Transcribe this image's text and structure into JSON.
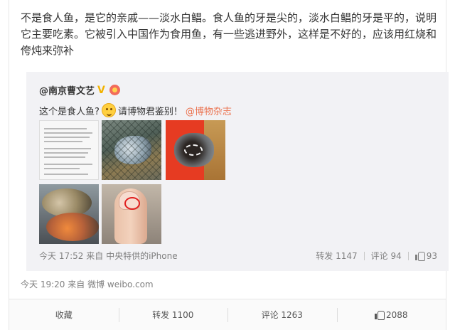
{
  "post": {
    "text": "不是食人鱼，是它的亲戚——淡水白鲳。食人鱼的牙是尖的，淡水白鲳的牙是平的，说明它主要吃素。它被引入中国作为食用鱼，有一些逃进野外，这样是不好的，应该用红烧和侉炖来弥补",
    "time": "今天 19:20",
    "source_prefix": "来自",
    "source": "微博 weibo.com"
  },
  "repost": {
    "author": "@南京曹文艺",
    "verified_icon": "verified-v-icon",
    "text_before": "这个是食人鱼?",
    "text_after": "请博物君鉴别！",
    "mention": "@博物杂志",
    "time": "今天 17:52",
    "source_prefix": "来自",
    "source": "中央特供的iPhone",
    "repost_label": "转发 1147",
    "comment_label": "评论 94",
    "like_count": "93",
    "images": [
      "text-screenshot-thumb",
      "fish-in-net-thumb",
      "fish-teeth-thumb",
      "two-fish-thumb",
      "fingernail-thumb"
    ]
  },
  "actions": {
    "favorite": "收藏",
    "repost": "转发 1100",
    "comment": "评论 1263",
    "like": "2088"
  },
  "colors": {
    "link": "#eb7350",
    "repost_bg": "#f2f2f5",
    "meta": "#808080"
  }
}
